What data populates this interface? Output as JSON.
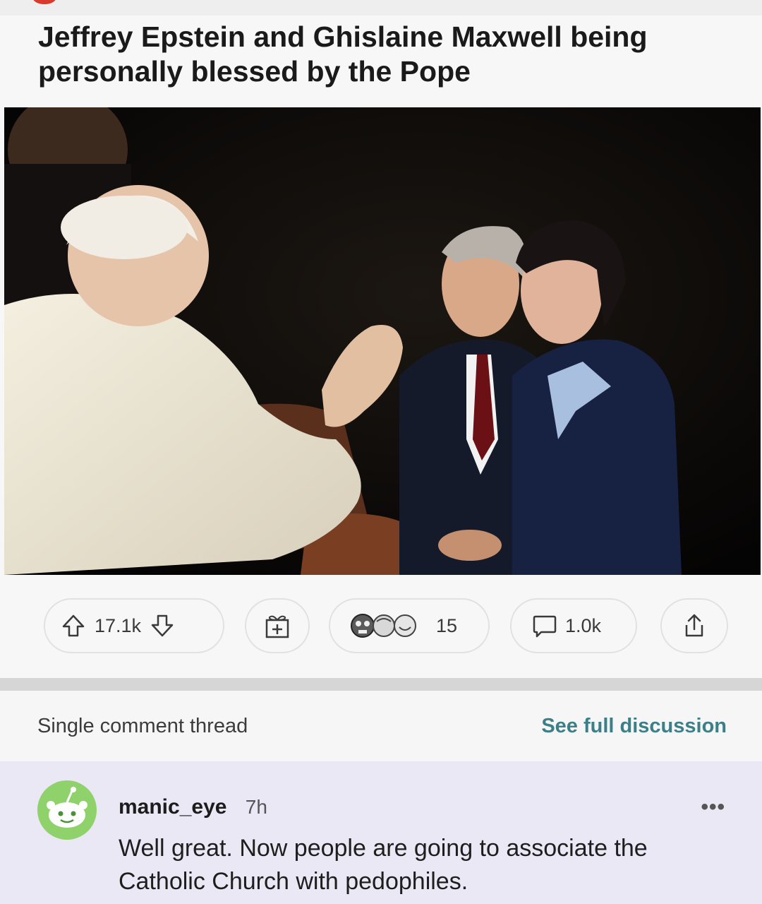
{
  "post": {
    "title": "Jeffrey Epstein and Ghislaine Maxwell being personally blessed by the Pope",
    "image_alt": "Photo of the Pope blessing Jeffrey Epstein and Ghislaine Maxwell"
  },
  "actions": {
    "upvotes": "17.1k",
    "awards_count": "15",
    "comments_count": "1.0k"
  },
  "thread": {
    "label": "Single comment thread",
    "link": "See full discussion"
  },
  "comment": {
    "username": "manic_eye",
    "time": "7h",
    "more": "•••",
    "text": "Well great. Now people are going to associate the Catholic Church with pedophiles."
  },
  "colors": {
    "link": "#3c7f88",
    "avatar_green": "#8fd16a",
    "comment_bg": "#e9e8f4"
  },
  "icons": [
    "upvote-icon",
    "downvote-icon",
    "gift-icon",
    "award-icon",
    "comment-icon",
    "share-icon",
    "more-icon",
    "snoo-avatar-icon"
  ]
}
